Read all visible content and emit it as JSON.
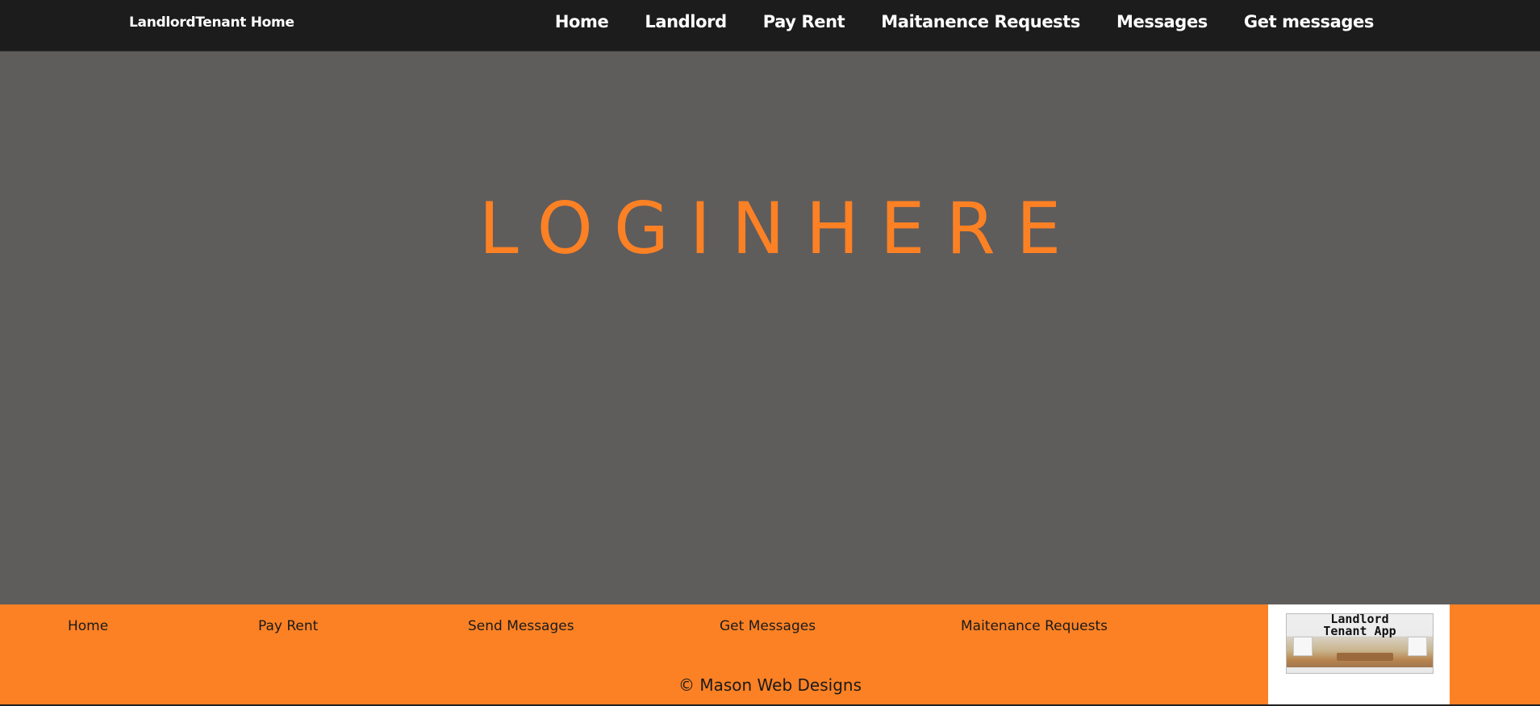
{
  "header": {
    "brand": "LandlordTenant Home",
    "nav": [
      "Home",
      "Landlord",
      "Pay Rent",
      "Maitanence Requests",
      "Messages",
      "Get messages"
    ]
  },
  "hero": {
    "title": "LOGINHERE"
  },
  "footer": {
    "links": [
      "Home",
      "Pay Rent",
      "Send Messages",
      "Get Messages",
      "Maitenance Requests"
    ],
    "copyright": "© Mason Web Designs",
    "logo_title": "Landlord\nTenant App"
  },
  "colors": {
    "topbar": "#1c1c1c",
    "hero_background": "#5f5c5c",
    "accent_orange": "#fc8124",
    "text_light": "#ffffff",
    "text_dark": "#1a1a1a"
  }
}
